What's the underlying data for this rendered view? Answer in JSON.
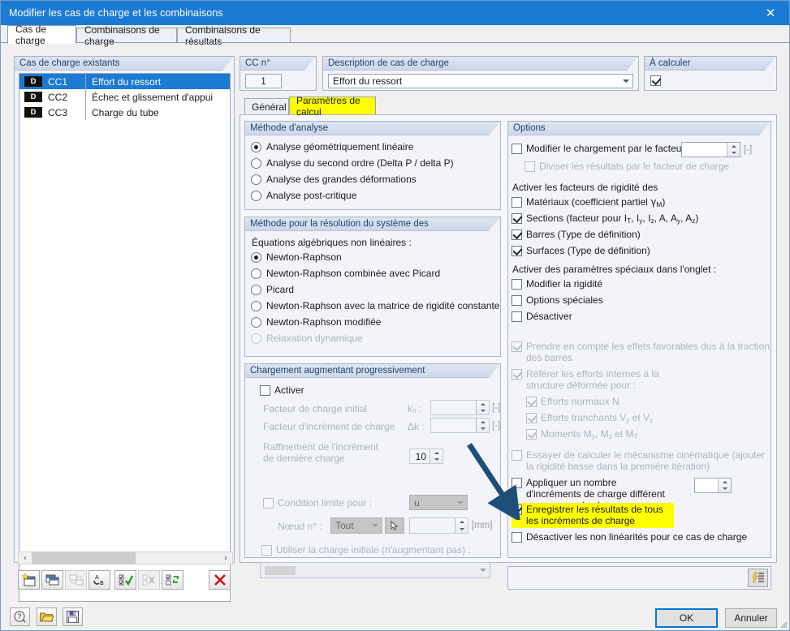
{
  "window": {
    "title": "Modifier les cas de charge et les combinaisons",
    "close_icon": "close-icon"
  },
  "tabs": [
    {
      "label": "Cas de charge",
      "active": true
    },
    {
      "label": "Combinaisons de charge",
      "active": false
    },
    {
      "label": "Combinaisons de résultats",
      "active": false
    }
  ],
  "existing": {
    "header": "Cas de charge existants",
    "rows": [
      {
        "badge": "D",
        "no": "CC1",
        "desc": "Effort du ressort",
        "selected": true
      },
      {
        "badge": "D",
        "no": "CC2",
        "desc": "Échec et glissement d'appui",
        "selected": false
      },
      {
        "badge": "D",
        "no": "CC3",
        "desc": "Charge du tube",
        "selected": false
      }
    ]
  },
  "cc_number": {
    "header": "CC n°",
    "value": "1"
  },
  "description": {
    "header": "Description de cas de charge",
    "value": "Effort du ressort"
  },
  "to_calculate": {
    "header": "À calculer",
    "checked": true
  },
  "inner_tabs": [
    {
      "label": "Général",
      "active": false
    },
    {
      "label": "Paramètres de calcul",
      "active": true,
      "highlight": "#ffff00"
    }
  ],
  "analysis_method": {
    "header": "Méthode d'analyse",
    "options": [
      {
        "label": "Analyse géométriquement linéaire",
        "selected": true
      },
      {
        "label": "Analyse du second ordre (Delta P / delta P)",
        "selected": false
      },
      {
        "label": "Analyse des grandes déformations",
        "selected": false
      },
      {
        "label": "Analyse post-critique",
        "selected": false
      }
    ]
  },
  "solver_method": {
    "header": "Méthode pour la résolution du système des",
    "subtitle": "Équations algébriques non linéaires :",
    "options": [
      {
        "label": "Newton-Raphson",
        "selected": true,
        "disabled": false
      },
      {
        "label": "Newton-Raphson combinée avec Picard",
        "selected": false,
        "disabled": false
      },
      {
        "label": "Picard",
        "selected": false,
        "disabled": false
      },
      {
        "label": "Newton-Raphson avec la matrice de rigidité constante",
        "selected": false,
        "disabled": false
      },
      {
        "label": "Newton-Raphson modifiée",
        "selected": false,
        "disabled": false
      },
      {
        "label": "Relaxation dynamique",
        "selected": false,
        "disabled": true
      }
    ]
  },
  "incremental": {
    "header": "Chargement augmentant progressivement",
    "activate": {
      "label": "Activer",
      "checked": false
    },
    "initial_factor": {
      "label": "Facteur de charge initial",
      "symbol": "k₀ :",
      "value": "",
      "unit": "[-]"
    },
    "increment_factor": {
      "label": "Facteur d'incrément de charge",
      "symbol": "Δk :",
      "value": "",
      "unit": "[-]"
    },
    "refinement": {
      "label": "Raffinement de l'incrément de dernière charge",
      "value": "10"
    },
    "limit_condition": {
      "label": "Condition limite pour :",
      "checked": false,
      "combo_value": "u"
    },
    "node": {
      "label": "Nœud n° :",
      "combo_value": "Tout",
      "pick_icon": "node-pick-icon",
      "value": "",
      "unit": "[mm]"
    },
    "initial_load": {
      "label": "Utiliser la charge initiale (n'augmentant pas) :",
      "checked": false,
      "combo_value": ""
    }
  },
  "options": {
    "header": "Options",
    "modify_load": {
      "label": "Modifier le chargement par le facteur :",
      "checked": false,
      "value": "",
      "unit": "[-]"
    },
    "divide_results": {
      "label": "Diviser les résultats par le facteur de charge",
      "checked": false,
      "disabled": true
    },
    "stiffness_header": "Activer les facteurs de rigidité des",
    "stiffness": [
      {
        "label": "Matériaux (coefficient partiel γM)",
        "checked": false
      },
      {
        "label": "Sections (facteur pour IT, Iy, Iz, A, Ay, Az)",
        "checked": true
      },
      {
        "label": "Barres (Type de définition)",
        "checked": true
      },
      {
        "label": "Surfaces (Type de définition)",
        "checked": true
      }
    ],
    "special_header": "Activer des paramètres spéciaux dans l'onglet :",
    "special": [
      {
        "label": "Modifier la rigidité",
        "checked": false
      },
      {
        "label": "Options spéciales",
        "checked": false
      },
      {
        "label": "Désactiver",
        "checked": false
      }
    ],
    "favorable": {
      "label": "Prendre en compte les effets favorables dus à la traction des barres",
      "checked": true,
      "disabled": true
    },
    "refer_internal": {
      "label": "Référer les efforts internes à la structure déformée pour :",
      "checked": true,
      "disabled": true
    },
    "refer_children": [
      {
        "label": "Efforts normaux N",
        "checked": true,
        "disabled": true
      },
      {
        "label": "Efforts tranchants Vy et Vz",
        "checked": true,
        "disabled": true
      },
      {
        "label": "Moments My, Mz et MT",
        "checked": true,
        "disabled": true
      }
    ],
    "kinematic": {
      "label": "Essayer de calculer le mécanisme cinématique (ajouter la rigidité basse dans la première itération)",
      "checked": false,
      "disabled": true
    },
    "different_increments": {
      "label": "Appliquer un nombre d'incréments de charge différent pour ce cas de charge :",
      "checked": false,
      "value": ""
    },
    "save_all_increments": {
      "label": "Enregistrer les résultats de tous les incréments de charge",
      "checked": true,
      "highlight": "#ffff00"
    },
    "disable_nonlinear": {
      "label": "Désactiver les non linéarités pour ce cas de charge",
      "checked": false
    }
  },
  "comment_bar": {
    "icon": "lightning-list-icon",
    "value": ""
  },
  "list_toolbar": {
    "buttons": [
      {
        "name": "new-load-case-button",
        "icon": "new-window-icon",
        "enabled": true
      },
      {
        "name": "copy-load-case-button",
        "icon": "copy-window-icon",
        "enabled": true
      },
      {
        "name": "renumber-button",
        "icon": "renumber-icon",
        "enabled": false
      },
      {
        "name": "sort-alpha-button",
        "icon": "sort-ab-icon",
        "enabled": true
      },
      {
        "name": "select-all-button",
        "icon": "check-all-icon",
        "enabled": true
      },
      {
        "name": "deselect-all-button",
        "icon": "uncheck-all-icon",
        "enabled": false
      },
      {
        "name": "invert-selection-button",
        "icon": "invert-selection-icon",
        "enabled": true
      },
      {
        "name": "delete-load-case-button",
        "icon": "red-x-icon",
        "enabled": true
      }
    ]
  },
  "bottom_toolbar": {
    "buttons": [
      {
        "name": "help-button",
        "icon": "help-question-icon"
      },
      {
        "name": "open-button",
        "icon": "open-folder-icon"
      },
      {
        "name": "save-button",
        "icon": "floppy-save-icon"
      }
    ]
  },
  "footer": {
    "ok_label": "OK",
    "cancel_label": "Annuler"
  },
  "scrollbar": {
    "left_arrow": "‹",
    "right_arrow": "›"
  },
  "annotation": {
    "type": "arrow",
    "color": "#1f4e79"
  },
  "colors": {
    "title_bar": "#1b7ad4",
    "selection": "#1b7ad4",
    "highlight": "#ffff00",
    "group_header_text": "#26416b",
    "accent_border": "#0078d7"
  }
}
